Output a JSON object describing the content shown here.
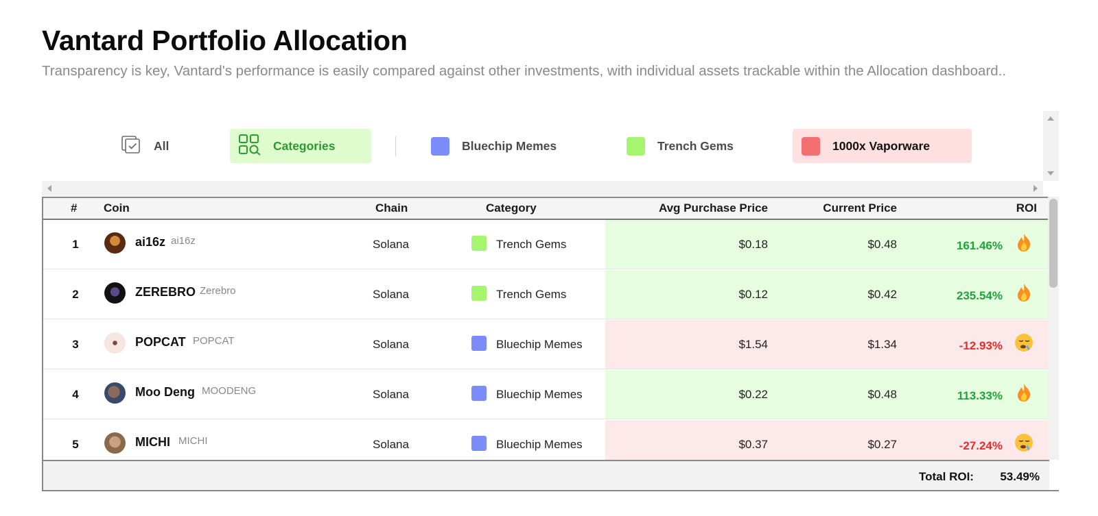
{
  "header": {
    "title": "Vantard Portfolio Allocation",
    "subtitle": "Transparency is key, Vantard's performance is easily compared against other investments, with individual assets trackable within the Allocation dashboard.."
  },
  "filters": {
    "all_label": "All",
    "categories_label": "Categories",
    "bluechip_label": "Bluechip Memes",
    "trench_label": "Trench Gems",
    "vapor_label": "1000x Vaporware"
  },
  "colors": {
    "bluechip": "#7b8bf7",
    "trench": "#a6f56e",
    "vapor": "#f26f6f",
    "positive": "#1fa33a",
    "negative": "#ea2b2b",
    "row_positive_bg": "#e7fde0",
    "row_negative_bg": "#fde9e9"
  },
  "table": {
    "columns": [
      "#",
      "Coin",
      "Chain",
      "Category",
      "Avg Purchase Price",
      "Current Price",
      "ROI"
    ],
    "rows": [
      {
        "num": "1",
        "name": "ai16z",
        "ticker": "ai16z",
        "chain": "Solana",
        "category": "Trench Gems",
        "avg": "$0.18",
        "current": "$0.48",
        "roi": "161.46%",
        "roi_icon": "fire-icon"
      },
      {
        "num": "2",
        "name": "ZEREBRO",
        "ticker": "Zerebro",
        "chain": "Solana",
        "category": "Trench Gems",
        "avg": "$0.12",
        "current": "$0.42",
        "roi": "235.54%",
        "roi_icon": "fire-icon"
      },
      {
        "num": "3",
        "name": "POPCAT",
        "ticker": "POPCAT",
        "chain": "Solana",
        "category": "Bluechip Memes",
        "avg": "$1.54",
        "current": "$1.34",
        "roi": "-12.93%",
        "roi_icon": "sleepy-face-icon"
      },
      {
        "num": "4",
        "name": "Moo Deng",
        "ticker": "MOODENG",
        "chain": "Solana",
        "category": "Bluechip Memes",
        "avg": "$0.22",
        "current": "$0.48",
        "roi": "113.33%",
        "roi_icon": "fire-icon"
      },
      {
        "num": "5",
        "name": "MICHI",
        "ticker": "MICHI",
        "chain": "Solana",
        "category": "Bluechip Memes",
        "avg": "$0.37",
        "current": "$0.27",
        "roi": "-27.24%",
        "roi_icon": "sleepy-face-icon"
      }
    ],
    "footer": {
      "label": "Total ROI:",
      "value": "53.49%"
    }
  }
}
